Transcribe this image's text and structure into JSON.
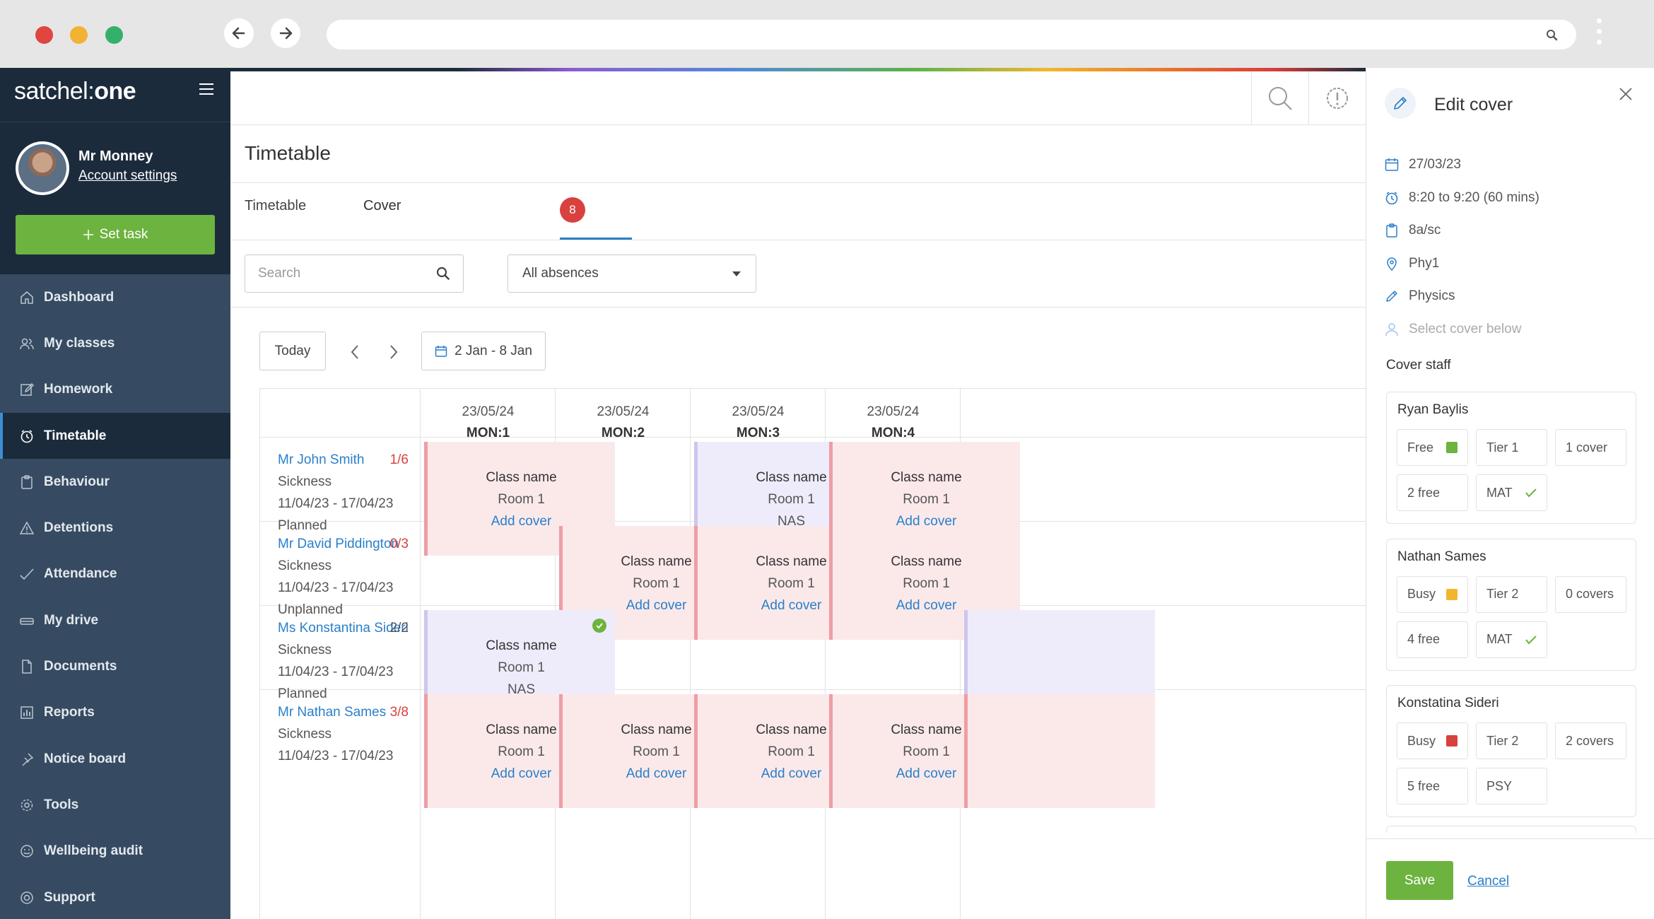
{
  "brand": {
    "name_part1": "satchel:",
    "name_part2": "one"
  },
  "user": {
    "name": "Mr Monney",
    "account_link": "Account settings"
  },
  "set_task": "Set task",
  "nav": [
    {
      "label": "Dashboard",
      "icon": "home-icon"
    },
    {
      "label": "My classes",
      "icon": "people-icon"
    },
    {
      "label": "Homework",
      "icon": "edit-icon"
    },
    {
      "label": "Timetable",
      "icon": "clock-icon",
      "active": true
    },
    {
      "label": "Behaviour",
      "icon": "clipboard-icon"
    },
    {
      "label": "Detentions",
      "icon": "warning-icon"
    },
    {
      "label": "Attendance",
      "icon": "check-icon"
    },
    {
      "label": "My drive",
      "icon": "drive-icon"
    },
    {
      "label": "Documents",
      "icon": "document-icon"
    },
    {
      "label": "Reports",
      "icon": "chart-icon"
    },
    {
      "label": "Notice board",
      "icon": "pin-icon"
    },
    {
      "label": "Tools",
      "icon": "gear-icon"
    },
    {
      "label": "Wellbeing audit",
      "icon": "smile-icon"
    },
    {
      "label": "Support",
      "icon": "lifebuoy-icon"
    }
  ],
  "page": {
    "title": "Timetable",
    "tabs": [
      {
        "label": "Timetable"
      },
      {
        "label": "Cover",
        "badge": "8"
      }
    ]
  },
  "filters": {
    "search_placeholder": "Search",
    "absence_select": "All absences"
  },
  "toolbar": {
    "today": "Today",
    "range": "2 Jan - 8 Jan"
  },
  "columns": [
    {
      "date": "23/05/24",
      "period": "MON:1"
    },
    {
      "date": "23/05/24",
      "period": "MON:2"
    },
    {
      "date": "23/05/24",
      "period": "MON:3"
    },
    {
      "date": "23/05/24",
      "period": "MON:4"
    }
  ],
  "teachers": [
    {
      "name": "Mr John Smith",
      "ratio": "1/6",
      "ratio_color": "#d9413e",
      "reason": "Sickness",
      "dates": "11/04/23 - 17/04/23",
      "status": "Planned"
    },
    {
      "name": "Mr David Piddington",
      "ratio": "0/3",
      "ratio_color": "#d9413e",
      "reason": "Sickness",
      "dates": "11/04/23 - 17/04/23",
      "status": "Unplanned"
    },
    {
      "name": "Ms Konstantina Sideri",
      "ratio": "2/2",
      "ratio_color": "#555555",
      "reason": "Sickness",
      "dates": "11/04/23 - 17/04/23",
      "status": "Planned"
    },
    {
      "name": "Mr Nathan Sames",
      "ratio": "3/8",
      "ratio_color": "#d9413e",
      "reason": "Sickness",
      "dates": "11/04/23 - 17/04/23",
      "status": ""
    }
  ],
  "cards": [
    {
      "row": 0,
      "col": 0,
      "class": "Class name",
      "room": "Room 1",
      "action": "Add cover",
      "covered": false
    },
    {
      "row": 0,
      "col": 2,
      "class": "Class name",
      "room": "Room 1",
      "action": "NAS",
      "covered": true
    },
    {
      "row": 0,
      "col": 3,
      "class": "Class name",
      "room": "Room 1",
      "action": "Add cover",
      "covered": false
    },
    {
      "row": 1,
      "col": 1,
      "class": "Class name",
      "room": "Room 1",
      "action": "Add cover",
      "covered": false
    },
    {
      "row": 1,
      "col": 2,
      "class": "Class name",
      "room": "Room 1",
      "action": "Add cover",
      "covered": false
    },
    {
      "row": 1,
      "col": 3,
      "class": "Class name",
      "room": "Room 1",
      "action": "Add cover",
      "covered": false
    },
    {
      "row": 2,
      "col": 0,
      "class": "Class name",
      "room": "Room 1",
      "action": "NAS",
      "covered": true
    },
    {
      "row": 3,
      "col": 0,
      "class": "Class name",
      "room": "Room 1",
      "action": "Add cover",
      "covered": false
    },
    {
      "row": 3,
      "col": 1,
      "class": "Class name",
      "room": "Room 1",
      "action": "Add cover",
      "covered": false
    },
    {
      "row": 3,
      "col": 2,
      "class": "Class name",
      "room": "Room 1",
      "action": "Add cover",
      "covered": false
    },
    {
      "row": 3,
      "col": 3,
      "class": "Class name",
      "room": "Room 1",
      "action": "Add cover",
      "covered": false
    }
  ],
  "panel": {
    "title": "Edit cover",
    "details": [
      {
        "icon": "calendar-icon",
        "text": "27/03/23"
      },
      {
        "icon": "clock-icon",
        "text": "8:20 to 9:20 (60 mins)"
      },
      {
        "icon": "clipboard-icon",
        "text": "8a/sc"
      },
      {
        "icon": "location-icon",
        "text": "Phy1"
      },
      {
        "icon": "pencil-icon",
        "text": "Physics"
      },
      {
        "icon": "person-icon",
        "text": "Select cover below",
        "muted": true
      }
    ],
    "cover_staff_heading": "Cover staff",
    "staff": [
      {
        "name": "Ryan Baylis",
        "status": "Free",
        "status_color": "#6db33f",
        "tier": "Tier 1",
        "covers": "1 cover",
        "free": "2 free",
        "dept": "MAT",
        "dept_check": true
      },
      {
        "name": "Nathan Sames",
        "status": "Busy",
        "status_color": "#f1b72c",
        "tier": "Tier 2",
        "covers": "0 covers",
        "free": "4 free",
        "dept": "MAT",
        "dept_check": true
      },
      {
        "name": "Konstatina Sideri",
        "status": "Busy",
        "status_color": "#d9413e",
        "tier": "Tier 2",
        "covers": "2 covers",
        "free": "5 free",
        "dept": "PSY",
        "dept_check": false
      }
    ],
    "save": "Save",
    "cancel": "Cancel"
  }
}
